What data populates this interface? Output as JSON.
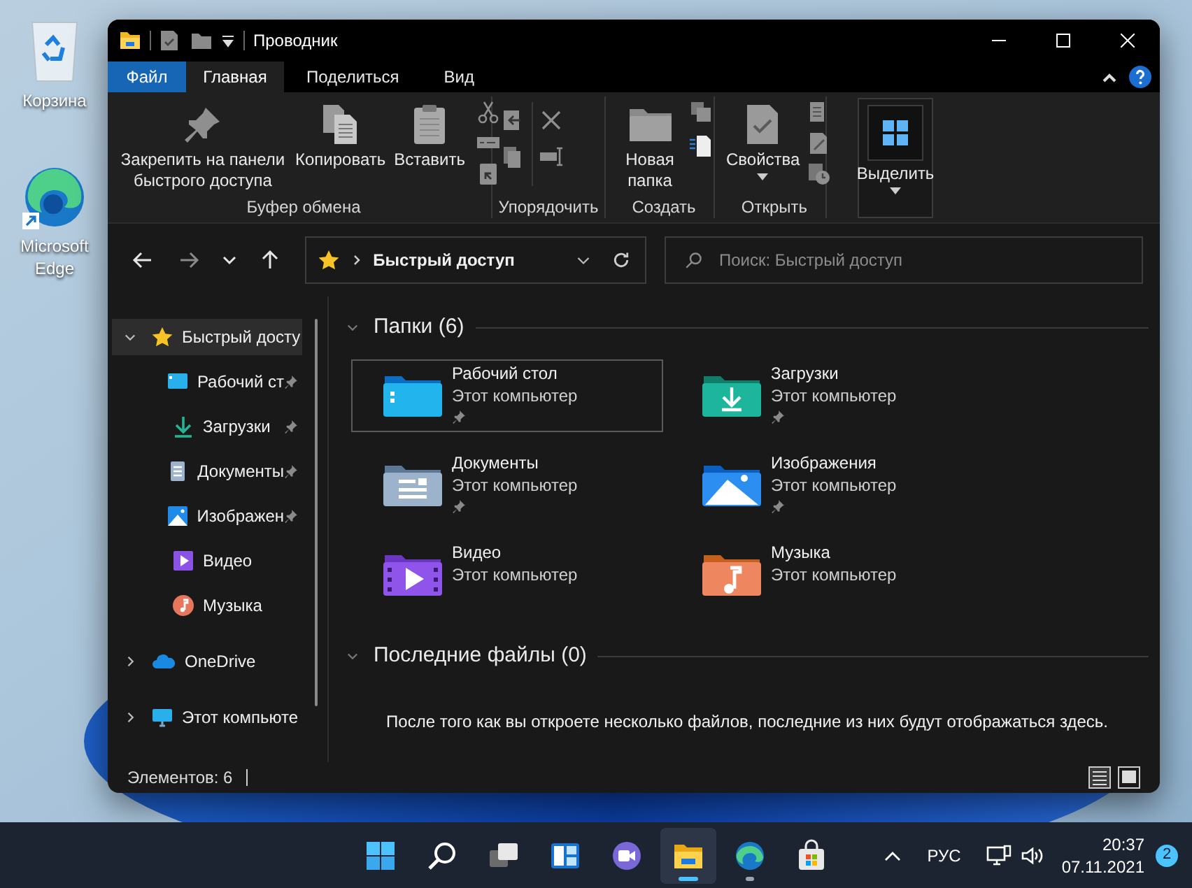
{
  "desktop_icons": [
    {
      "label": "Корзина",
      "kind": "recycle-bin"
    },
    {
      "label": "Microsoft Edge",
      "kind": "edge"
    }
  ],
  "window": {
    "title": "Проводник"
  },
  "ribbon_tabs": [
    {
      "label": "Файл",
      "kind": "file",
      "selected": false
    },
    {
      "label": "Главная",
      "kind": "tab",
      "selected": true
    },
    {
      "label": "Поделиться",
      "kind": "tab",
      "selected": false
    },
    {
      "label": "Вид",
      "kind": "tab",
      "selected": false
    }
  ],
  "ribbon_groups": [
    {
      "kind": "clipboard",
      "label": "Буфер обмена",
      "buttons": [
        {
          "label": "Закрепить на панели быстрого доступа",
          "kind": "pin",
          "pressed": false
        },
        {
          "label": "Копировать",
          "kind": "copy",
          "pressed": false
        },
        {
          "label": "Вставить",
          "kind": "paste",
          "pressed": false
        }
      ]
    },
    {
      "kind": "organize",
      "label": "Упорядочить"
    },
    {
      "kind": "new",
      "label": "Создать",
      "buttons": [
        {
          "label": "Новая папка",
          "kind": "new-folder",
          "pressed": false
        }
      ]
    },
    {
      "kind": "open",
      "label": "Открыть",
      "buttons": [
        {
          "label": "Свойства",
          "kind": "properties",
          "pressed": false
        }
      ]
    },
    {
      "kind": "select",
      "buttons": [
        {
          "label": "Выделить",
          "kind": "select",
          "pressed": true
        }
      ]
    }
  ],
  "navigation": {
    "buttons": [
      {
        "kind": "back",
        "disabled": false
      },
      {
        "kind": "forward",
        "disabled": true
      },
      {
        "kind": "recent",
        "disabled": false
      },
      {
        "kind": "up",
        "disabled": false
      }
    ],
    "address": "Быстрый доступ",
    "search_placeholder": "Поиск: Быстрый доступ"
  },
  "sidebar": {
    "items": [
      {
        "label": "Быстрый досту",
        "kind": "star",
        "expanded": true,
        "selected": true,
        "children": [
          {
            "label": "Рабочий ст",
            "kind": "desktop",
            "pinned": true,
            "selected": false
          },
          {
            "label": "Загрузки",
            "kind": "downloads",
            "pinned": true,
            "selected": false
          },
          {
            "label": "Документы",
            "kind": "documents",
            "pinned": true,
            "selected": false
          },
          {
            "label": "Изображен",
            "kind": "pictures",
            "pinned": true,
            "selected": false
          },
          {
            "label": "Видео",
            "kind": "videos",
            "pinned": false,
            "selected": false
          },
          {
            "label": "Музыка",
            "kind": "music",
            "pinned": false,
            "selected": false
          }
        ]
      },
      {
        "label": "OneDrive",
        "kind": "onedrive",
        "expanded": false,
        "selected": false
      },
      {
        "label": "Этот компьюте",
        "kind": "computer",
        "expanded": false,
        "selected": false
      }
    ]
  },
  "folders": {
    "title": "Папки (6)",
    "expanded": true,
    "items": [
      {
        "name": "Рабочий стол",
        "location": "Этот компьютер",
        "kind": "desktop",
        "pinned": true,
        "selected": true
      },
      {
        "name": "Загрузки",
        "location": "Этот компьютер",
        "kind": "downloads",
        "pinned": true,
        "selected": false
      },
      {
        "name": "Документы",
        "location": "Этот компьютер",
        "kind": "documents",
        "pinned": true,
        "selected": false
      },
      {
        "name": "Изображения",
        "location": "Этот компьютер",
        "kind": "pictures",
        "pinned": true,
        "selected": false
      },
      {
        "name": "Видео",
        "location": "Этот компьютер",
        "kind": "videos",
        "pinned": false,
        "selected": false
      },
      {
        "name": "Музыка",
        "location": "Этот компьютер",
        "kind": "music",
        "pinned": false,
        "selected": false
      }
    ]
  },
  "recent_files": {
    "title": "Последние файлы (0)",
    "expanded": true,
    "message": "После того как вы откроете несколько файлов, последние из них будут отображаться здесь."
  },
  "status_bar": {
    "count": "Элементов: 6"
  },
  "taskbar": {
    "apps": [
      {
        "kind": "start",
        "active": false,
        "running": false
      },
      {
        "kind": "search",
        "active": false,
        "running": false
      },
      {
        "kind": "task-view",
        "active": false,
        "running": false
      },
      {
        "kind": "widgets",
        "active": false,
        "running": false
      },
      {
        "kind": "chat",
        "active": false,
        "running": false
      },
      {
        "kind": "explorer",
        "active": true,
        "running": true
      },
      {
        "kind": "edge",
        "active": false,
        "running": true
      },
      {
        "kind": "store",
        "active": false,
        "running": false
      }
    ],
    "language": "РУС",
    "time": "20:37",
    "date": "07.11.2021",
    "notifications": "2"
  }
}
